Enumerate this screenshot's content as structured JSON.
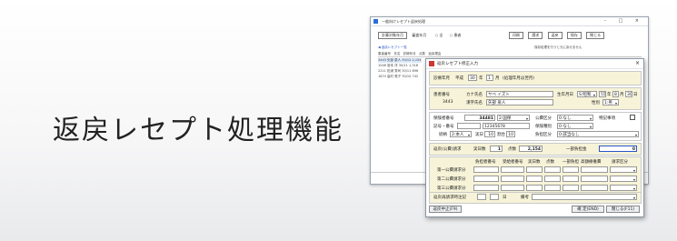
{
  "headline": "返戻レセプト処理機能",
  "back_window": {
    "title": "一般向けレセプト返戻処理",
    "controls": "- □ ×",
    "toolbar": {
      "btn1": "計算対象年月",
      "label2": "審査年月",
      "radio1": "○ 全",
      "radio2": "○ 患者",
      "right_btns": [
        "印刷",
        "請求",
        "返戻",
        "保存",
        "閉じる"
      ]
    },
    "link_text": "◀ 返戻レセプト一覧",
    "note": "保存処理を行うと元に戻せません",
    "header_cols": [
      "患者番号",
      "氏名",
      "診療年月",
      "点数",
      "返戻理由"
    ],
    "rows": [
      {
        "no": "3443",
        "name": "矢部 泉人",
        "ym": "30/12",
        "pt": "2,154"
      },
      {
        "no": "1046",
        "name": "宮本 洋",
        "ym": "30/11",
        "pt": "1,318"
      },
      {
        "no": "2211",
        "name": "松浦 秀司",
        "ym": "30/11",
        "pt": "896"
      },
      {
        "no": "1874",
        "name": "高村 晃子",
        "ym": "30/10",
        "pt": "742"
      }
    ]
  },
  "dialog": {
    "title": "返戻レセプト修正入力",
    "close": "×",
    "claim_ym_label": "診療年月",
    "era": "平成",
    "year": "30",
    "year_unit": "年",
    "month": "1",
    "month_unit": "月",
    "claim_note": "(処理年月は翌月)",
    "patient_no_label": "患者番号",
    "patient_no": "3443",
    "kana_label": "カナ氏名",
    "kana": "ヤベ イズト",
    "name_label": "漢字氏名",
    "name": "矢部 泉人",
    "birth_label": "生年月日",
    "birth_era": "S:昭和",
    "birth_y": "55",
    "birth_m": "8",
    "birth_d": "30",
    "y": "年",
    "m": "月",
    "d": "日",
    "sex_label": "性別",
    "sex": "1:男",
    "insurer_label": "保険者番号",
    "insurer_no": "34481",
    "insurance_type": "2:国保",
    "public_label": "公費区分",
    "public_val": "0:なし",
    "special_label": "特記事項",
    "symbol_label": "記号・番号",
    "symbol": "",
    "number": "12345678",
    "cat_label": "保険種別",
    "cat_val": "0:なし",
    "benefit_label": "続柄",
    "benefit_val": "2:本人",
    "ratio_label": "割合",
    "days_label": "実日",
    "days": "10",
    "ratio": "10",
    "copay_label": "負担区分",
    "copay_val": "0:該当なし",
    "total_pts_label": "返戻(公費)請求",
    "num_label": "実日数",
    "num_val": "1",
    "pts_label": "点数",
    "pts_val": "2,154",
    "partial_label": "一部負担金",
    "partial_val": "0",
    "grid_header": [
      "負担者番号",
      "受給者番号",
      "実日数",
      "点数",
      "一部負担",
      "高額療養費",
      "請求区分"
    ],
    "grid_rows": [
      "第一公費請求分",
      "第二公費請求分",
      "第三公費請求分"
    ],
    "note_label": "返戻再請求時注記",
    "note_mark": "日",
    "remarks_label": "備考",
    "cancel_btn": "返戻中止(F9)",
    "confirm_btn": "確 定(END)",
    "close_btn": "閉じる(F11)"
  }
}
